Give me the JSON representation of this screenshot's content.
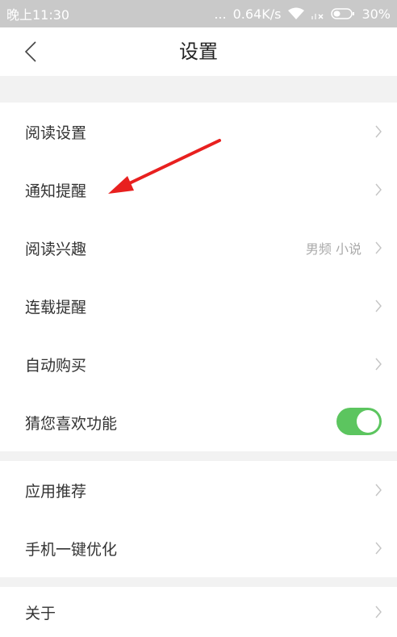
{
  "status_bar": {
    "time": "晚上11:30",
    "dots": "...",
    "speed": "0.64K/s",
    "battery": "30%"
  },
  "header": {
    "title": "设置"
  },
  "settings": {
    "items": [
      {
        "label": "阅读设置"
      },
      {
        "label": "通知提醒"
      },
      {
        "label": "阅读兴趣",
        "value": "男频 小说"
      },
      {
        "label": "连载提醒"
      },
      {
        "label": "自动购买"
      },
      {
        "label": "猜您喜欢功能",
        "toggle_on": true
      },
      {
        "label": "应用推荐"
      },
      {
        "label": "手机一键优化"
      },
      {
        "label": "关于"
      }
    ]
  },
  "colors": {
    "toggle_on": "#5cc55f",
    "annotation_arrow": "#e8201f",
    "status_bar": "#c9c9c9"
  }
}
